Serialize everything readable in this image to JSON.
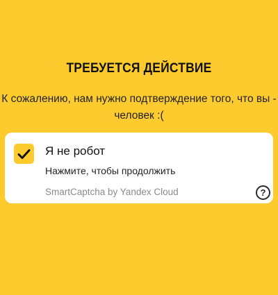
{
  "page": {
    "title": "ТРЕБУЕТСЯ ДЕЙСТВИЕ",
    "message_line1": "К сожалению, нам нужно подтверждение того, что вы -",
    "message_line2": "человек :("
  },
  "captcha": {
    "checkbox_state": "checked",
    "title": "Я не робот",
    "subtitle": "Нажмите, чтобы продолжить",
    "brand": "SmartCaptcha by Yandex Cloud",
    "help_glyph": "?"
  },
  "colors": {
    "background": "#FECB2F",
    "card": "#FFFFFF",
    "checkbox": "#FECB2F",
    "brand_text": "#8A8A8A"
  },
  "icons": {
    "checkbox": "checkmark-icon",
    "help": "question-circle-icon"
  }
}
